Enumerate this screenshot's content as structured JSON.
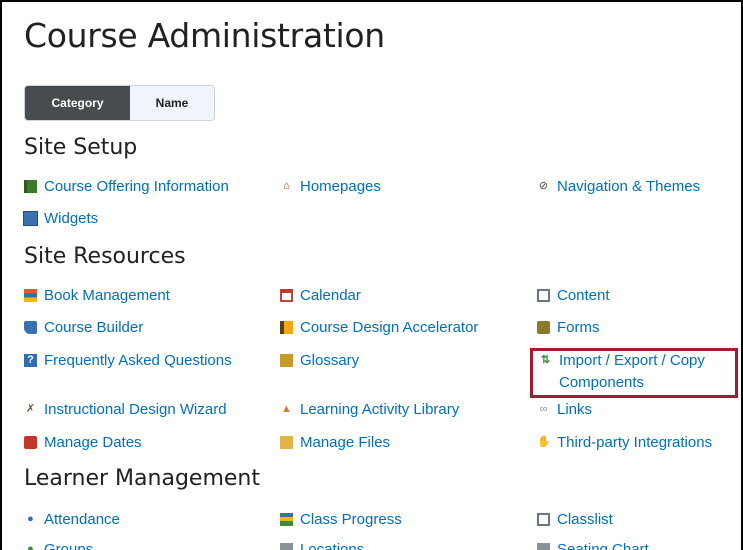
{
  "page": {
    "title": "Course Administration"
  },
  "view_toggle": {
    "category_label": "Category",
    "name_label": "Name"
  },
  "sections": {
    "site_setup": {
      "heading": "Site Setup",
      "items": [
        {
          "label": "Course Offering Information",
          "icon": "book-icon"
        },
        {
          "label": "Homepages",
          "icon": "home-icon"
        },
        {
          "label": "Navigation & Themes",
          "icon": "navigation-icon"
        },
        {
          "label": "Widgets",
          "icon": "widget-icon"
        }
      ]
    },
    "site_resources": {
      "heading": "Site Resources",
      "items": [
        {
          "label": "Book Management",
          "icon": "book-stack-icon"
        },
        {
          "label": "Calendar",
          "icon": "calendar-icon"
        },
        {
          "label": "Content",
          "icon": "content-icon"
        },
        {
          "label": "Course Builder",
          "icon": "builder-icon"
        },
        {
          "label": "Course Design Accelerator",
          "icon": "accelerator-icon"
        },
        {
          "label": "Forms",
          "icon": "forms-icon"
        },
        {
          "label": "Frequently Asked Questions",
          "icon": "faq-icon"
        },
        {
          "label": "Glossary",
          "icon": "glossary-icon"
        },
        {
          "label": "Import / Export / Copy Components",
          "icon": "import-export-icon"
        },
        {
          "label": "Instructional Design Wizard",
          "icon": "wizard-icon"
        },
        {
          "label": "Learning Activity Library",
          "icon": "activity-library-icon"
        },
        {
          "label": "Links",
          "icon": "links-icon"
        },
        {
          "label": "Manage Dates",
          "icon": "dates-icon"
        },
        {
          "label": "Manage Files",
          "icon": "folder-icon"
        },
        {
          "label": "Third-party Integrations",
          "icon": "integrations-icon"
        }
      ]
    },
    "learner_management": {
      "heading": "Learner Management",
      "items": [
        {
          "label": "Attendance",
          "icon": "attendance-icon"
        },
        {
          "label": "Class Progress",
          "icon": "progress-icon"
        },
        {
          "label": "Classlist",
          "icon": "classlist-icon"
        },
        {
          "label": "Groups",
          "icon": "groups-icon"
        },
        {
          "label": "Locations",
          "icon": "locations-icon"
        },
        {
          "label": "Seating Chart",
          "icon": "seating-chart-icon"
        }
      ]
    }
  },
  "highlight_color": "#a6192e",
  "link_color": "#006fbf"
}
